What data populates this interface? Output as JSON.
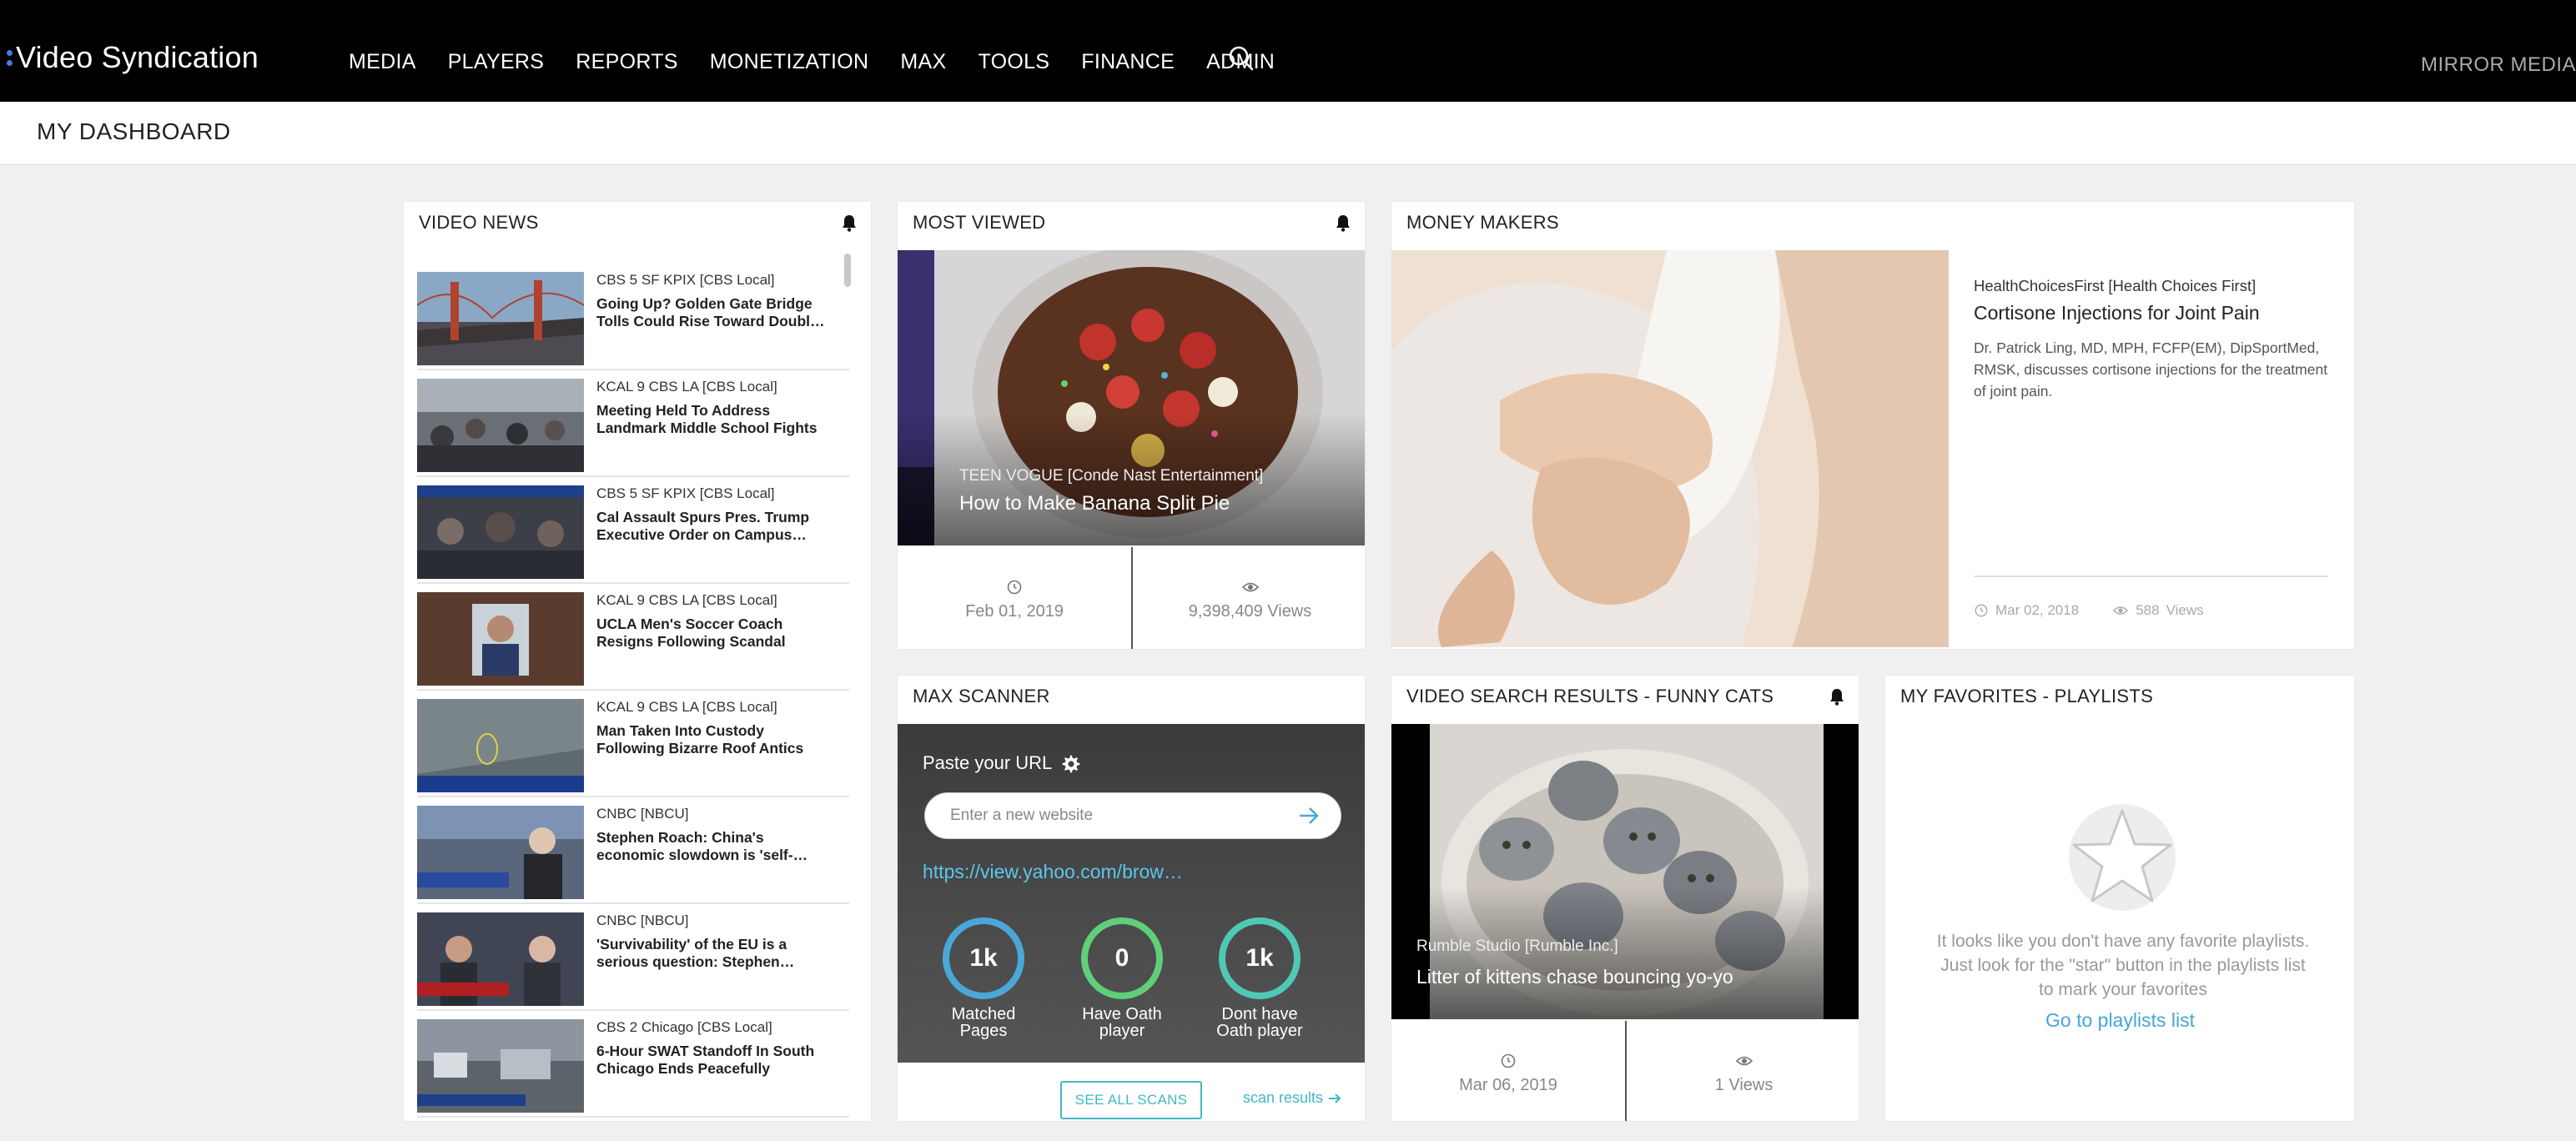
{
  "app": {
    "logo": "Video Syndication",
    "account": "MIRROR MEDIA"
  },
  "nav": {
    "items": [
      "MEDIA",
      "PLAYERS",
      "REPORTS",
      "MONETIZATION",
      "MAX",
      "TOOLS",
      "FINANCE",
      "ADMIN"
    ],
    "search_icon": "search-icon"
  },
  "page": {
    "title": "MY DASHBOARD"
  },
  "video_news": {
    "title": "VIDEO NEWS",
    "items": [
      {
        "source": "CBS 5 SF KPIX [CBS Local]",
        "title": "Going Up? Golden Gate Bridge\nTolls Could Rise Toward Doubl…"
      },
      {
        "source": "KCAL 9 CBS LA [CBS Local]",
        "title": "Meeting Held To Address\nLandmark Middle School Fights"
      },
      {
        "source": "CBS 5 SF KPIX [CBS Local]",
        "title": "Cal Assault Spurs Pres. Trump\nExecutive Order on Campus…"
      },
      {
        "source": "KCAL 9 CBS LA [CBS Local]",
        "title": "UCLA Men's Soccer Coach\nResigns Following Scandal"
      },
      {
        "source": "KCAL 9 CBS LA [CBS Local]",
        "title": "Man Taken Into Custody\nFollowing Bizarre Roof Antics"
      },
      {
        "source": "CNBC [NBCU]",
        "title": "Stephen Roach: China's\neconomic slowdown is 'self-…"
      },
      {
        "source": "CNBC [NBCU]",
        "title": "'Survivability' of the EU is a\nserious question: Stephen…"
      },
      {
        "source": "CBS 2 Chicago [CBS Local]",
        "title": "6-Hour SWAT Standoff In South\nChicago Ends Peacefully"
      }
    ]
  },
  "most_viewed": {
    "title": "MOST VIEWED",
    "source": "TEEN VOGUE [Conde Nast Entertainment]",
    "video_title": "How to Make Banana Split Pie",
    "date": "Feb 01, 2019",
    "views": "9,398,409 Views"
  },
  "money_makers": {
    "title": "MONEY MAKERS",
    "source": "HealthChoicesFirst [Health Choices First]",
    "video_title": "Cortisone Injections for Joint Pain",
    "description": "Dr. Patrick Ling, MD, MPH, FCFP(EM), DipSportMed, RMSK, discusses cortisone injections for the treatment of joint pain.",
    "date": "Mar 02, 2018",
    "views": "588",
    "views_label": "Views"
  },
  "max_scanner": {
    "title": "MAX SCANNER",
    "paste_label": "Paste your URL",
    "input_placeholder": "Enter a new website",
    "scanned_url": "https://view.yahoo.com/brow…",
    "metrics": [
      {
        "value": "1k",
        "label": "Matched\nPages",
        "color": "#4aa8d8"
      },
      {
        "value": "0",
        "label": "Have Oath\nplayer",
        "color": "#5fcf7a"
      },
      {
        "value": "1k",
        "label": "Dont have\nOath player",
        "color": "#4fc9b6"
      }
    ],
    "see_all": "SEE ALL SCANS",
    "scan_results": "scan results"
  },
  "video_search": {
    "title": "VIDEO SEARCH RESULTS - FUNNY CATS",
    "source": "Rumble Studio [Rumble Inc.]",
    "video_title": "Litter of kittens chase bouncing yo-yo",
    "date": "Mar 06, 2019",
    "views": "1 Views"
  },
  "favorites": {
    "title": "MY FAVORITES - PLAYLISTS",
    "empty_text": "It looks like you don't have any favorite playlists. Just look for the \"star\" button in the playlists list to mark your favorites",
    "link": "Go to playlists list"
  },
  "colors": {
    "accent": "#43a7d7",
    "teal": "#41b8c4",
    "nav_bg": "#000000"
  }
}
